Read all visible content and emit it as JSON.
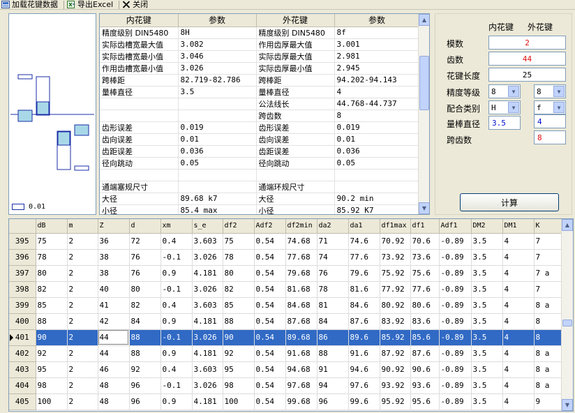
{
  "toolbar": {
    "load_label": "加载花键数据",
    "export_label": "导出Excel",
    "close_label": "关闭"
  },
  "diagram": {
    "legend_value": "0.01"
  },
  "param_table": {
    "headers": [
      "内花键",
      "参数",
      "外花键",
      "参数"
    ],
    "rows": [
      [
        "精度级别 DIN5480",
        "8H",
        "精度级别 DIN5480",
        "8f"
      ],
      [
        "实际齿槽宽最大值",
        "3.082",
        "作用齿厚最大值",
        "3.001"
      ],
      [
        "实际齿槽宽最小值",
        "3.046",
        "实际齿厚最大值",
        "2.981"
      ],
      [
        "作用齿槽宽最小值",
        "3.026",
        "实际齿厚最小值",
        "2.945"
      ],
      [
        "跨棒距",
        "82.719-82.786",
        "跨棒距",
        "94.202-94.143"
      ],
      [
        "量棒直径",
        "3.5",
        "量棒直径",
        "4"
      ],
      [
        "",
        "",
        "公法线长",
        "44.768-44.737"
      ],
      [
        "",
        "",
        "跨齿数",
        "8"
      ],
      [
        "齿形误差",
        "0.019",
        "齿形误差",
        "0.019"
      ],
      [
        "齿向误差",
        "0.01",
        "齿向误差",
        "0.01"
      ],
      [
        "齿距误差",
        "0.036",
        "齿距误差",
        "0.036"
      ],
      [
        "径向跳动",
        "0.05",
        "径向跳动",
        "0.05"
      ],
      [
        "",
        "",
        "",
        ""
      ],
      [
        "通端塞规尺寸",
        "",
        "通端环规尺寸",
        ""
      ],
      [
        "大径",
        "89.68 k7",
        "大径",
        "90.2 min"
      ],
      [
        "小径",
        "85.4 max",
        "小径",
        "85.92 K7"
      ]
    ]
  },
  "inputs": {
    "col_inner": "内花键",
    "col_outer": "外花键",
    "module_label": "模数",
    "module_value": "2",
    "teeth_label": "齿数",
    "teeth_value": "44",
    "length_label": "花键长度",
    "length_value": "25",
    "grade_label": "精度等级",
    "grade_inner": "8",
    "grade_outer": "8",
    "fit_label": "配合类别",
    "fit_inner": "H",
    "fit_outer": "f",
    "pin_label": "量棒直径",
    "pin_inner": "3.5",
    "pin_outer": "4",
    "span_label": "跨齿数",
    "span_outer": "8",
    "calc_label": "计算"
  },
  "grid": {
    "columns": [
      "dB",
      "m",
      "Z",
      "d",
      "xm",
      "s_e",
      "df2",
      "Adf2",
      "df2min",
      "da2",
      "da1",
      "df1max",
      "df1",
      "Adf1",
      "DM2",
      "DM1",
      "K"
    ],
    "rows": [
      {
        "n": "395",
        "cells": [
          "75",
          "2",
          "36",
          "72",
          "0.4",
          "3.603",
          "75",
          "0.54",
          "74.68",
          "71",
          "74.6",
          "70.92",
          "70.6",
          "-0.89",
          "3.5",
          "4",
          "7"
        ]
      },
      {
        "n": "396",
        "cells": [
          "78",
          "2",
          "38",
          "76",
          "-0.1",
          "3.026",
          "78",
          "0.54",
          "77.68",
          "74",
          "77.6",
          "73.92",
          "73.6",
          "-0.89",
          "3.5",
          "4",
          "7"
        ]
      },
      {
        "n": "397",
        "cells": [
          "80",
          "2",
          "38",
          "76",
          "0.9",
          "4.181",
          "80",
          "0.54",
          "79.68",
          "76",
          "79.6",
          "75.92",
          "75.6",
          "-0.89",
          "3.5",
          "4",
          "7 a"
        ]
      },
      {
        "n": "398",
        "cells": [
          "82",
          "2",
          "40",
          "80",
          "-0.1",
          "3.026",
          "82",
          "0.54",
          "81.68",
          "78",
          "81.6",
          "77.92",
          "77.6",
          "-0.89",
          "3.5",
          "4",
          "7"
        ]
      },
      {
        "n": "399",
        "cells": [
          "85",
          "2",
          "41",
          "82",
          "0.4",
          "3.603",
          "85",
          "0.54",
          "84.68",
          "81",
          "84.6",
          "80.92",
          "80.6",
          "-0.89",
          "3.5",
          "4",
          "8 a"
        ]
      },
      {
        "n": "400",
        "cells": [
          "88",
          "2",
          "42",
          "84",
          "0.9",
          "4.181",
          "88",
          "0.54",
          "87.68",
          "84",
          "87.6",
          "83.92",
          "83.6",
          "-0.89",
          "3.5",
          "4",
          "8"
        ]
      },
      {
        "n": "401",
        "cells": [
          "90",
          "2",
          "44",
          "88",
          "-0.1",
          "3.026",
          "90",
          "0.54",
          "89.68",
          "86",
          "89.6",
          "85.92",
          "85.6",
          "-0.89",
          "3.5",
          "4",
          "8"
        ]
      },
      {
        "n": "402",
        "cells": [
          "92",
          "2",
          "44",
          "88",
          "0.9",
          "4.181",
          "92",
          "0.54",
          "91.68",
          "88",
          "91.6",
          "87.92",
          "87.6",
          "-0.89",
          "3.5",
          "4",
          "8 a"
        ]
      },
      {
        "n": "403",
        "cells": [
          "95",
          "2",
          "46",
          "92",
          "0.4",
          "3.603",
          "95",
          "0.54",
          "94.68",
          "91",
          "94.6",
          "90.92",
          "90.6",
          "-0.89",
          "3.5",
          "4",
          "8 a"
        ]
      },
      {
        "n": "404",
        "cells": [
          "98",
          "2",
          "48",
          "96",
          "-0.1",
          "3.026",
          "98",
          "0.54",
          "97.68",
          "94",
          "97.6",
          "93.92",
          "93.6",
          "-0.89",
          "3.5",
          "4",
          "8 a"
        ]
      },
      {
        "n": "405",
        "cells": [
          "100",
          "2",
          "48",
          "96",
          "0.9",
          "4.181",
          "100",
          "0.54",
          "99.68",
          "96",
          "99.6",
          "95.92",
          "95.6",
          "-0.89",
          "3.5",
          "4",
          "9"
        ]
      }
    ],
    "selected_row": "401"
  }
}
